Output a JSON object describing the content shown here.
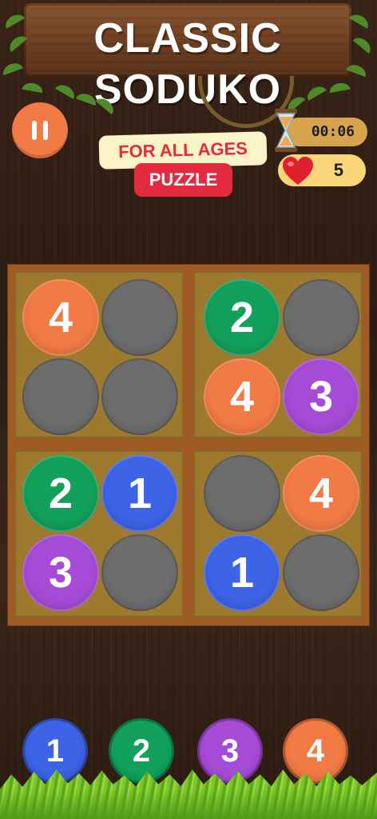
{
  "header": {
    "title": "CLASSIC SODUKO",
    "tag_ages": "FOR ALL AGES",
    "tag_puzzle": "PUZZLE"
  },
  "status": {
    "timer": "00:06",
    "lives": "5"
  },
  "colors": {
    "orange": "#f27a44",
    "green": "#12a05a",
    "purple": "#a54bd6",
    "blue": "#3d63e6",
    "empty": "#6d6d6d",
    "board": "#a05a26",
    "box": "#9d7a2d"
  },
  "board": {
    "cells": [
      [
        {
          "v": "4",
          "color": "orange"
        },
        {
          "v": "",
          "color": "empty"
        },
        {
          "v": "2",
          "color": "green"
        },
        {
          "v": "",
          "color": "empty"
        }
      ],
      [
        {
          "v": "",
          "color": "empty"
        },
        {
          "v": "",
          "color": "empty"
        },
        {
          "v": "4",
          "color": "orange"
        },
        {
          "v": "3",
          "color": "purple"
        }
      ],
      [
        {
          "v": "2",
          "color": "green"
        },
        {
          "v": "1",
          "color": "blue"
        },
        {
          "v": "",
          "color": "empty"
        },
        {
          "v": "4",
          "color": "orange"
        }
      ],
      [
        {
          "v": "3",
          "color": "purple"
        },
        {
          "v": "",
          "color": "empty"
        },
        {
          "v": "1",
          "color": "blue"
        },
        {
          "v": "",
          "color": "empty"
        }
      ]
    ]
  },
  "picker": [
    {
      "label": "1",
      "color": "blue"
    },
    {
      "label": "2",
      "color": "green"
    },
    {
      "label": "3",
      "color": "purple"
    },
    {
      "label": "4",
      "color": "orange"
    }
  ],
  "icons": {
    "pause": "pause-icon",
    "timer": "hourglass-icon",
    "lives": "heart-icon"
  }
}
